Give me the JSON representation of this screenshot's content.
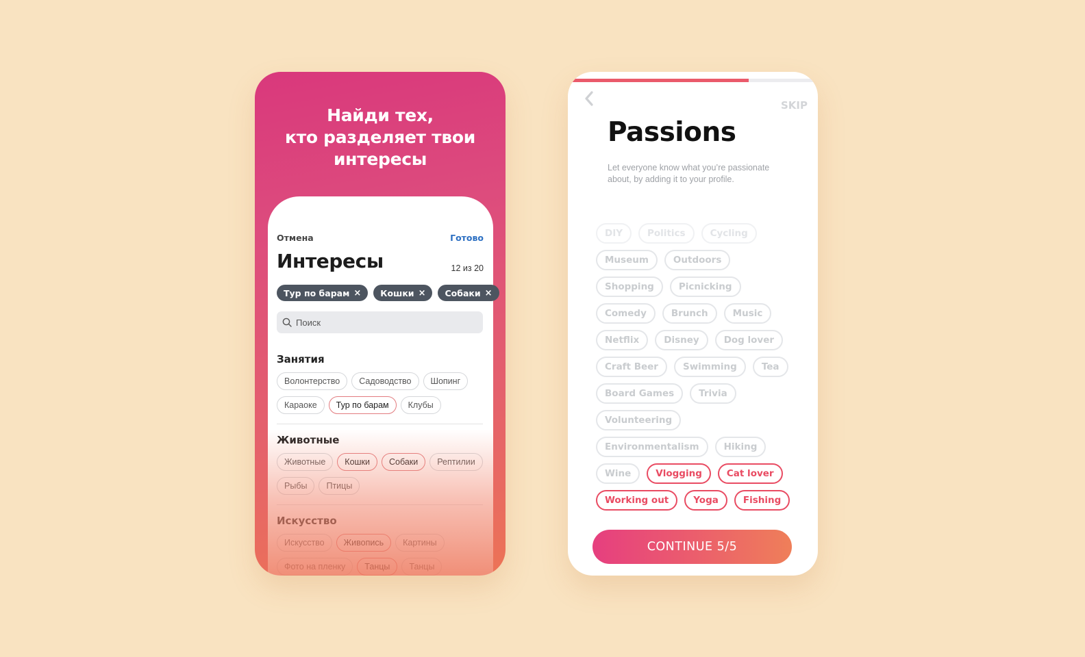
{
  "left_screen": {
    "hero_lines": [
      "Найди тех,",
      "кто разделяет твои",
      "интересы"
    ],
    "cancel_label": "Отмена",
    "done_label": "Готово",
    "title": "Интересы",
    "count": "12 из 20",
    "selected_chips": [
      "Тур по барам",
      "Кошки",
      "Собаки"
    ],
    "remove_glyph": "×",
    "search_placeholder": "Поиск",
    "sections": [
      {
        "title": "Занятия",
        "chips": [
          {
            "label": "Волонтерство",
            "selected": false
          },
          {
            "label": "Садоводство",
            "selected": false
          },
          {
            "label": "Шопинг",
            "selected": false
          },
          {
            "label": "Караоке",
            "selected": false
          },
          {
            "label": "Тур по барам",
            "selected": true
          },
          {
            "label": "Клубы",
            "selected": false
          }
        ]
      },
      {
        "title": "Животные",
        "chips": [
          {
            "label": "Животные",
            "selected": false
          },
          {
            "label": "Кошки",
            "selected": true
          },
          {
            "label": "Собаки",
            "selected": true
          },
          {
            "label": "Рептилии",
            "selected": false
          },
          {
            "label": "Рыбы",
            "selected": false
          },
          {
            "label": "Птицы",
            "selected": false
          }
        ]
      },
      {
        "title": "Искусство",
        "chips": [
          {
            "label": "Искусство",
            "selected": false
          },
          {
            "label": "Живопись",
            "selected": true
          },
          {
            "label": "Картины",
            "selected": false
          },
          {
            "label": "Фото на пленку",
            "selected": false
          },
          {
            "label": "Танцы",
            "selected": true
          },
          {
            "label": "Танцы",
            "selected": false
          }
        ]
      }
    ]
  },
  "right_screen": {
    "progress_fraction": 0.72,
    "skip_label": "SKIP",
    "title": "Passions",
    "description": "Let everyone know what you’re passionate about, by adding it to your profile.",
    "rows": [
      [
        {
          "label": "DIY",
          "state": "faint"
        },
        {
          "label": "Politics",
          "state": "faint"
        },
        {
          "label": "Cycling",
          "state": "faint"
        }
      ],
      [
        {
          "label": "Museum",
          "state": "off"
        },
        {
          "label": "Outdoors",
          "state": "off"
        }
      ],
      [
        {
          "label": "Shopping",
          "state": "off"
        },
        {
          "label": "Picnicking",
          "state": "off"
        }
      ],
      [
        {
          "label": "Comedy",
          "state": "off"
        },
        {
          "label": "Brunch",
          "state": "off"
        },
        {
          "label": "Music",
          "state": "off"
        }
      ],
      [
        {
          "label": "Netflix",
          "state": "off"
        },
        {
          "label": "Disney",
          "state": "off"
        },
        {
          "label": "Dog lover",
          "state": "off"
        }
      ],
      [
        {
          "label": "Craft Beer",
          "state": "off"
        },
        {
          "label": "Swimming",
          "state": "off"
        },
        {
          "label": "Tea",
          "state": "off"
        }
      ],
      [
        {
          "label": "Board Games",
          "state": "off"
        },
        {
          "label": "Trivia",
          "state": "off"
        }
      ],
      [
        {
          "label": "Volunteering",
          "state": "off"
        }
      ],
      [
        {
          "label": "Environmentalism",
          "state": "off"
        },
        {
          "label": "Hiking",
          "state": "off"
        }
      ],
      [
        {
          "label": "Wine",
          "state": "off"
        },
        {
          "label": "Vlogging",
          "state": "on"
        },
        {
          "label": "Cat lover",
          "state": "on"
        }
      ],
      [
        {
          "label": "Working out",
          "state": "on"
        },
        {
          "label": "Yoga",
          "state": "on"
        },
        {
          "label": "Fishing",
          "state": "on"
        }
      ]
    ],
    "continue_label": "CONTINUE 5/5"
  },
  "colors": {
    "background": "#f9e3c1",
    "accent_pink": "#e63f7f",
    "accent_orange": "#ef7f59",
    "selected_chip_red": "#e94b62",
    "done_blue": "#2c6fc2"
  }
}
